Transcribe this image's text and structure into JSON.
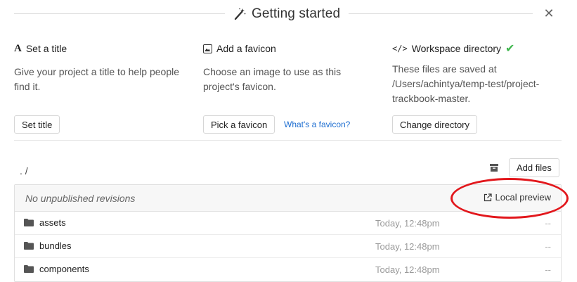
{
  "header": {
    "title": "Getting started",
    "close_icon": "close-icon",
    "title_icon": "magic-wand-icon"
  },
  "steps": [
    {
      "icon": "A",
      "icon_name": "title-icon",
      "heading": "Set a title",
      "description": "Give your project a title to help people find it.",
      "button": "Set title"
    },
    {
      "icon_name": "image-icon",
      "heading": "Add a favicon",
      "description": "Choose an image to use as this project's favicon.",
      "button": "Pick a favicon",
      "link": "What's a favicon?"
    },
    {
      "icon": "</>",
      "icon_name": "code-icon",
      "heading": "Workspace directory",
      "description": "These files are saved at /Users/achintya/temp-test/project-trackbook-master.",
      "button": "Change directory",
      "status_icon": "checkmark-icon"
    }
  ],
  "files": {
    "path": ". /",
    "add_files": "Add files",
    "status": "No unpublished revisions",
    "local_preview": "Local preview",
    "rows": [
      {
        "name": "assets",
        "modified": "Today, 12:48pm",
        "size": "--"
      },
      {
        "name": "bundles",
        "modified": "Today, 12:48pm",
        "size": "--"
      },
      {
        "name": "components",
        "modified": "Today, 12:48pm",
        "size": "--"
      }
    ]
  },
  "colors": {
    "link": "#1f6fd1",
    "check": "#3bb54a",
    "annotation": "#e2171c"
  }
}
